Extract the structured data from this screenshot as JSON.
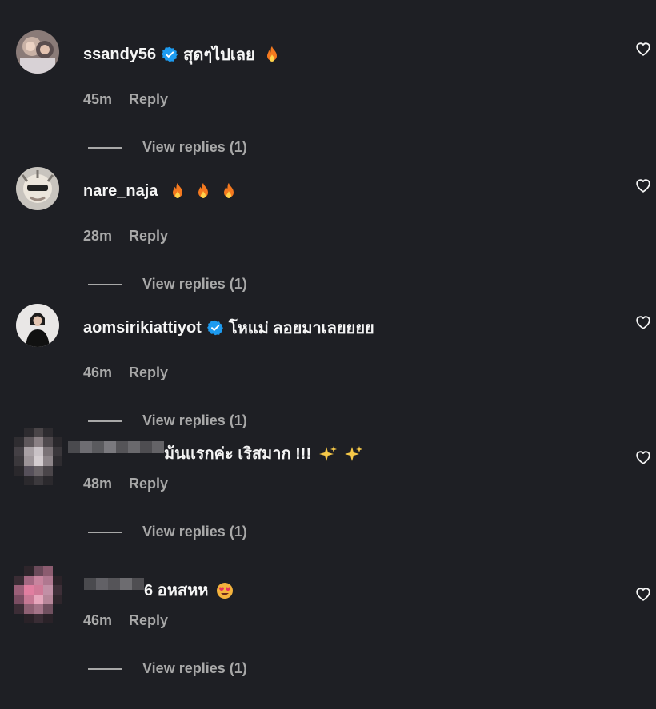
{
  "colors": {
    "background": "#1e1f24",
    "text_primary": "#f5f5f5",
    "text_secondary": "#a8a8a8",
    "verified_blue": "#1d9bf0",
    "fire_orange": "#f4791f"
  },
  "comments": [
    {
      "username": "ssandy56",
      "verified": true,
      "text": "สุดๆไปเลย",
      "emojis": [
        "fire-emoji"
      ],
      "time": "45m",
      "reply_label": "Reply",
      "view_replies": "View replies (1)",
      "like_icon": "heart-outline-icon"
    },
    {
      "username": "nare_naja",
      "verified": false,
      "text": "",
      "emojis": [
        "fire-emoji",
        "fire-emoji",
        "fire-emoji"
      ],
      "time": "28m",
      "reply_label": "Reply",
      "view_replies": "View replies (1)",
      "like_icon": "heart-outline-icon"
    },
    {
      "username": "aomsirikiattiyot",
      "verified": true,
      "text": "โหแม่ ลอยมาเลยยยย",
      "emojis": [],
      "time": "46m",
      "reply_label": "Reply",
      "view_replies": "View replies (1)",
      "like_icon": "heart-outline-icon"
    },
    {
      "username": "",
      "verified": false,
      "text": "ม้นแรกค่ะ เริสมาก !!!",
      "emojis": [
        "sparkles-emoji",
        "sparkles-emoji"
      ],
      "time": "48m",
      "reply_label": "Reply",
      "view_replies": "View replies (1)",
      "like_icon": "heart-outline-icon"
    },
    {
      "username": "",
      "verified": false,
      "text": "6 อหสหห",
      "emojis": [
        "heart-eyes-emoji"
      ],
      "time": "46m",
      "reply_label": "Reply",
      "view_replies": "View replies (1)",
      "like_icon": "heart-outline-icon"
    }
  ]
}
